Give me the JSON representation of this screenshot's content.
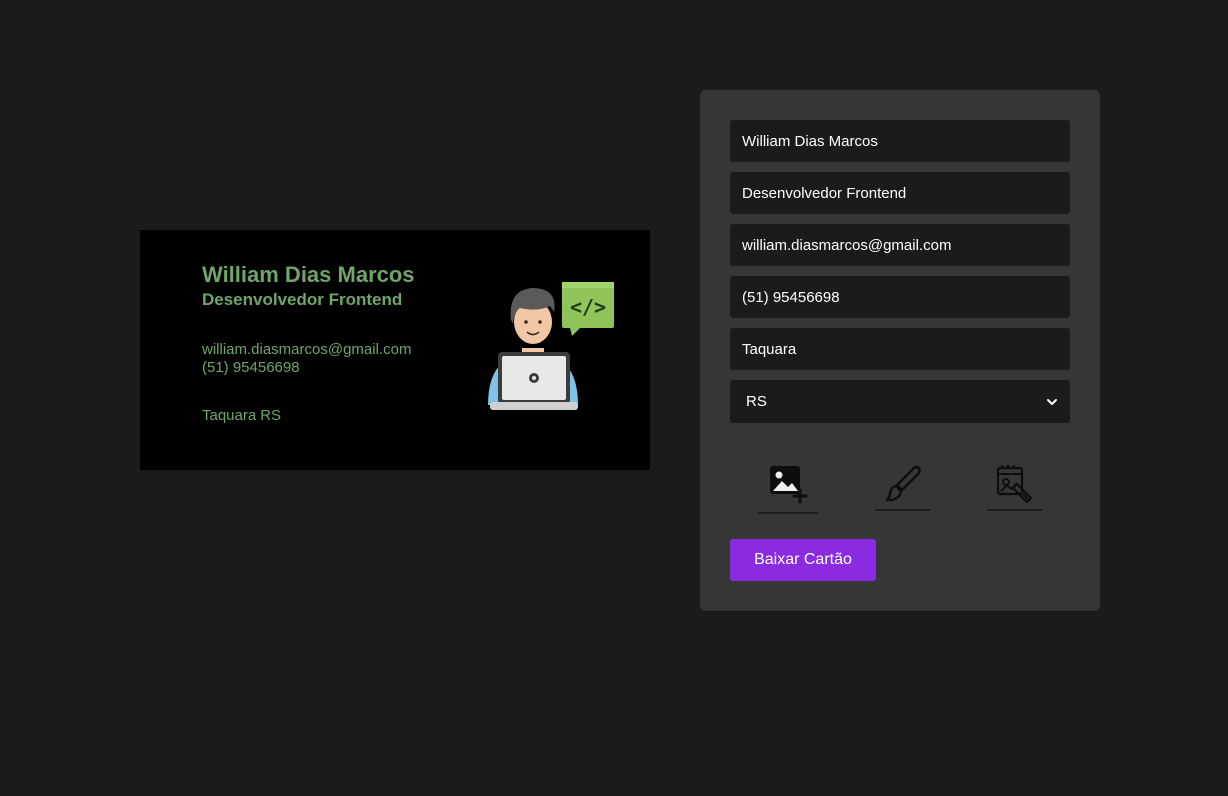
{
  "card": {
    "name": "William Dias Marcos",
    "role": "Desenvolvedor Frontend",
    "email": "william.diasmarcos@gmail.com",
    "phone": "(51) 95456698",
    "city": "Taquara",
    "state": "RS",
    "illustration_icon": "developer-laptop-code-icon",
    "text_color": "#6fa46b",
    "background_color": "#000000"
  },
  "form": {
    "name_value": "William Dias Marcos",
    "role_value": "Desenvolvedor Frontend",
    "email_value": "william.diasmarcos@gmail.com",
    "phone_value": "(51) 95456698",
    "city_value": "Taquara",
    "state_selected": "RS",
    "tools": [
      {
        "icon": "add-image-icon"
      },
      {
        "icon": "paint-brush-icon"
      },
      {
        "icon": "color-palette-icon"
      }
    ],
    "download_label": "Baixar Cartão",
    "accent_color": "#8a2be2"
  }
}
